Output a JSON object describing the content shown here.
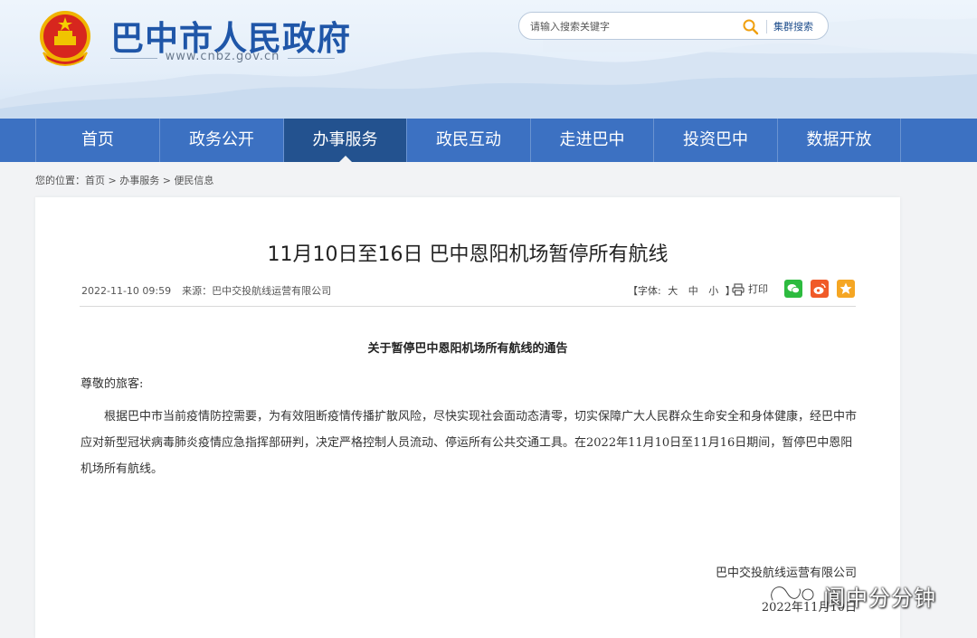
{
  "header": {
    "site_title": "巴中市人民政府",
    "site_url": "www.cnbz.gov.cn",
    "search": {
      "placeholder": "请输入搜索关键字",
      "group_search_label": "集群搜索"
    }
  },
  "nav": {
    "items": [
      {
        "label": "首页",
        "active": false
      },
      {
        "label": "政务公开",
        "active": false
      },
      {
        "label": "办事服务",
        "active": true
      },
      {
        "label": "政民互动",
        "active": false
      },
      {
        "label": "走进巴中",
        "active": false
      },
      {
        "label": "投资巴中",
        "active": false
      },
      {
        "label": "数据开放",
        "active": false
      }
    ]
  },
  "breadcrumb": {
    "prefix": "您的位置：",
    "items": [
      "首页",
      "办事服务",
      "便民信息"
    ],
    "separator": " > "
  },
  "article": {
    "title": "11月10日至16日 巴中恩阳机场暂停所有航线",
    "date": "2022-11-10 09:59",
    "source_label": "来源：",
    "source": "巴中交投航线运营有限公司",
    "font_size": {
      "open": "【字体:",
      "large": "大",
      "medium": "中",
      "small": "小",
      "close": "】"
    },
    "print_label": "打印",
    "notice_title": "关于暂停巴中恩阳机场所有航线的通告",
    "greeting": "尊敬的旅客:",
    "body": "根据巴中市当前疫情防控需要，为有效阻断疫情传播扩散风险，尽快实现社会面动态清零，切实保障广大人民群众生命安全和身体健康，经巴中市应对新型冠状病毒肺炎疫情应急指挥部研判，决定严格控制人员流动、停运所有公共交通工具。在2022年11月10日至11月16日期间，暂停巴中恩阳机场所有航线。",
    "signature_company": "巴中交投航线运营有限公司",
    "signature_date": "2022年11月10日"
  },
  "share": {
    "wechat_color": "#2dbb3f",
    "weibo_color": "#f05a28",
    "favorite_color": "#f5a623"
  },
  "watermark": {
    "text": "阆中分分钟"
  },
  "colors": {
    "brand_blue": "#1f56a8",
    "nav_bg": "#3c71c2",
    "nav_active": "#23528f"
  }
}
